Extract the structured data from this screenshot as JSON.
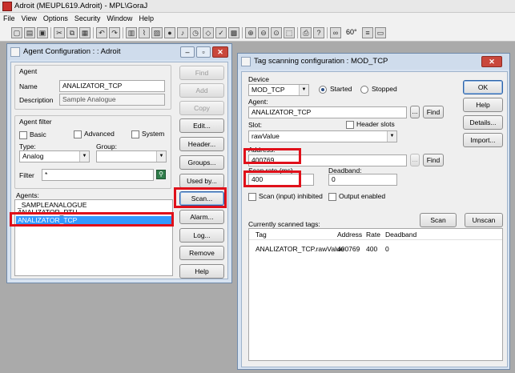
{
  "app": {
    "title": "Adroit (MEUPL619.Adroit) - MPL\\GoraJ",
    "menu": [
      "File",
      "View",
      "Options",
      "Security",
      "Window",
      "Help"
    ]
  },
  "toolbar": {
    "icons": [
      "new-icon",
      "open-icon",
      "save-icon",
      "print-icon",
      "cut-icon",
      "copy-icon",
      "paste-icon",
      "undo-icon",
      "redo-icon",
      "chart-icon",
      "trend-icon",
      "graph-icon",
      "globe-icon",
      "alarm-icon",
      "clock-icon",
      "tag-icon",
      "check-icon",
      "gallery-icon",
      "zoom-in-icon",
      "zoom-out-icon",
      "zoom-icon",
      "fit-icon",
      "print-preview-icon",
      "help-icon",
      "pointer-icon",
      "binoculars-icon",
      "script-icon",
      "window-icon"
    ],
    "zoom_label": "60°"
  },
  "agent_dialog": {
    "title": "Agent Configuration : : Adroit",
    "agent_group": "Agent",
    "name_label": "Name",
    "name_value": "ANALIZATOR_TCP",
    "description_label": "Description",
    "description_value": "Sample Analogue",
    "filter_group": "Agent filter",
    "basic_label": "Basic",
    "advanced_label": "Advanced",
    "system_label": "System",
    "type_label": "Type:",
    "type_value": "Analog",
    "group_label": "Group:",
    "group_value": "",
    "filter_label": "Filter",
    "filter_value": "*",
    "agents_label": "Agents:",
    "agents": [
      "_SAMPLEANALOGUE",
      "ANALIZATOR_RTU",
      "ANALIZATOR_TCP"
    ],
    "selected_agent": "ANALIZATOR_TCP",
    "buttons": {
      "find": "Find",
      "add": "Add",
      "copy": "Copy",
      "edit": "Edit...",
      "header": "Header...",
      "groups": "Groups...",
      "used_by": "Used by...",
      "scan": "Scan...",
      "alarm": "Alarm...",
      "log": "Log...",
      "remove": "Remove",
      "help": "Help"
    }
  },
  "scan_dialog": {
    "title": "Tag scanning configuration : MOD_TCP",
    "device_label": "Device",
    "device_value": "MOD_TCP",
    "started_label": "Started",
    "stopped_label": "Stopped",
    "agent_label": "Agent:",
    "agent_value": "ANALIZATOR_TCP",
    "browse_label": "...",
    "find_label": "Find",
    "slot_label": "Slot:",
    "header_slots_label": "Header slots",
    "slot_value": "rawValue",
    "address_label": "Address:",
    "address_value": "400769",
    "scan_rate_label": "Scan rate (ms)",
    "scan_rate_value": "400",
    "deadband_label": "Deadband:",
    "deadband_value": "0",
    "scan_inhibited_label": "Scan (input) inhibited",
    "output_enabled_label": "Output enabled",
    "scan_button": "Scan",
    "unscan_button": "Unscan",
    "currently_scanned_label": "Currently scanned tags:",
    "table_headers": [
      "Tag",
      "Address",
      "Rate",
      "Deadband"
    ],
    "table_rows": [
      [
        "ANALIZATOR_TCP.rawValue",
        "400769",
        "400",
        "0"
      ]
    ],
    "buttons": {
      "ok": "OK",
      "help": "Help",
      "details": "Details...",
      "import": "Import..."
    }
  },
  "colors": {
    "highlight": "#e0101a",
    "selection": "#3399ff",
    "dialog_frame": "#d7e3f1"
  }
}
